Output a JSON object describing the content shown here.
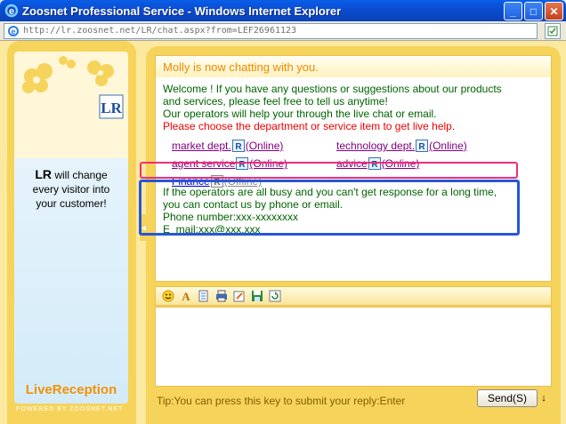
{
  "window": {
    "title": "Zoosnet Professional Service - Windows Internet Explorer",
    "minimize": "_",
    "maximize": "□",
    "close": "✕"
  },
  "address": {
    "url": "http://lr.zoosnet.net/LR/chat.aspx?from=LEF26961123"
  },
  "left_panel": {
    "tagline_brand": "LR",
    "tagline_line1": " will change",
    "tagline_line2": "every visitor into",
    "tagline_line3": "your customer!",
    "brand_name": "LiveReception",
    "powered": "POWERED BY ZOOSNET.NET"
  },
  "chat": {
    "header": "Molly is now chatting with you.",
    "welcome1": "Welcome ! If you have any questions or suggestions about our products",
    "welcome2": "and services, please feel free to tell us anytime!",
    "welcome3": "Our operators will help your through the live chat or email.",
    "choose": "Please choose the department or service item to get live help.",
    "departments": [
      {
        "name": "market dept.",
        "status": "(Online)"
      },
      {
        "name": "technology dept.",
        "status": "(Online)"
      },
      {
        "name": "agent service",
        "status": "(Online)"
      },
      {
        "name": "advice",
        "status": "(Online)"
      },
      {
        "name": "Finance",
        "status": "(Offline)"
      }
    ],
    "busy1": "If the operators are all busy and you can't get response for a long time,",
    "busy2": "you can contact us by phone or email.",
    "phone": "Phone number:xxx-xxxxxxxx",
    "email": "E_mail:xxx@xxx.xxx"
  },
  "toolbar": {
    "icons": [
      "smiley-icon",
      "font-icon",
      "file-icon",
      "print-icon",
      "edit-icon",
      "save-icon",
      "refresh-icon"
    ]
  },
  "footer": {
    "tip": "Tip:You can press this key to submit your reply:Enter",
    "send_label": "Send(S)",
    "send_arrow": "↓"
  },
  "colors": {
    "accent_orange": "#f28900",
    "panel_yellow": "#f6d35a",
    "message_green": "#006400",
    "highlight_pink": "#ee2d7a",
    "highlight_blue": "#2757d8"
  }
}
